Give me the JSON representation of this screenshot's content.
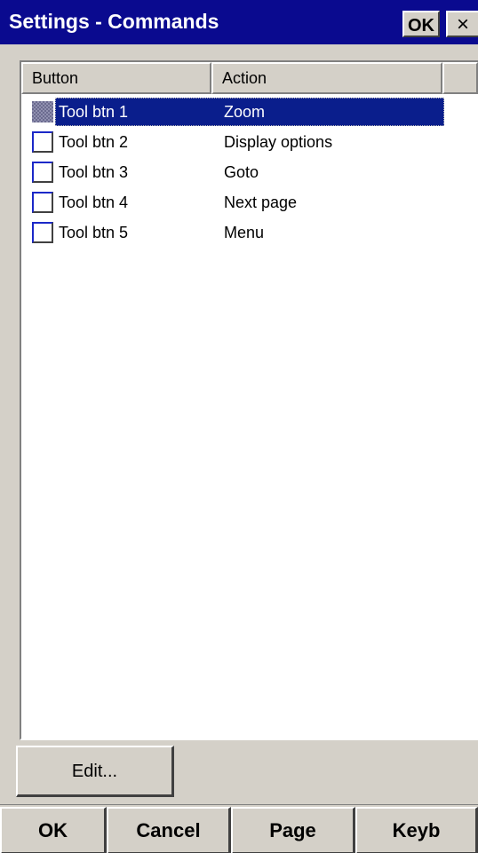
{
  "window": {
    "title": "Settings - Commands",
    "ok_label": "OK",
    "close_glyph": "×",
    "title_bar_color": "#0a0a8f"
  },
  "list": {
    "columns": [
      "Button",
      "Action"
    ],
    "rows": [
      {
        "button": "Tool btn 1",
        "action": "Zoom",
        "selected": true
      },
      {
        "button": "Tool btn 2",
        "action": "Display options",
        "selected": false
      },
      {
        "button": "Tool btn 3",
        "action": "Goto",
        "selected": false
      },
      {
        "button": "Tool btn 4",
        "action": "Next page",
        "selected": false
      },
      {
        "button": "Tool btn 5",
        "action": "Menu",
        "selected": false
      }
    ],
    "selection_color": "#0a1e8c"
  },
  "edit_button": {
    "label": "Edit..."
  },
  "softkeys": [
    "OK",
    "Cancel",
    "Page",
    "Keyb"
  ]
}
